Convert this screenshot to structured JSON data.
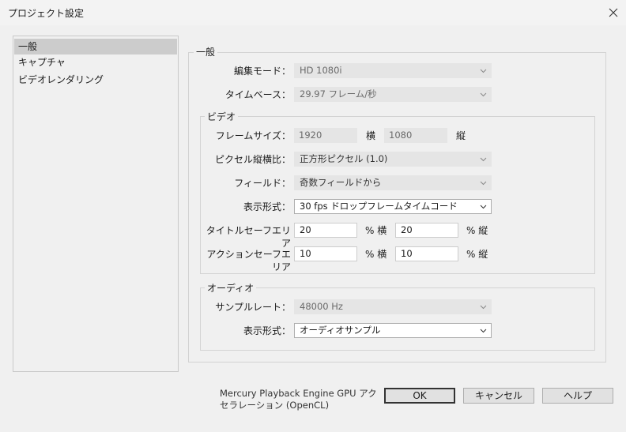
{
  "window": {
    "title": "プロジェクト設定",
    "close_icon": "close-icon"
  },
  "sidebar": {
    "items": [
      {
        "label": "一般",
        "selected": true
      },
      {
        "label": "キャプチャ",
        "selected": false
      },
      {
        "label": "ビデオレンダリング",
        "selected": false
      }
    ]
  },
  "general": {
    "group_label": "一般",
    "edit_mode": {
      "label": "編集モード：",
      "value": "HD 1080i"
    },
    "timebase": {
      "label": "タイムベース：",
      "value": "29.97 フレーム/秒"
    },
    "video": {
      "group_label": "ビデオ",
      "frame_size": {
        "label": "フレームサイズ：",
        "width": "1920",
        "width_unit": "横",
        "height": "1080",
        "height_unit": "縦"
      },
      "pixel_aspect": {
        "label": "ピクセル縦横比：",
        "value": "正方形ピクセル (1.0)"
      },
      "fields": {
        "label": "フィールド：",
        "value": "奇数フィールドから"
      },
      "display_format": {
        "label": "表示形式：",
        "value": "30 fps ドロップフレームタイムコード"
      },
      "title_safe": {
        "label": "タイトルセーフエリア",
        "h": "20",
        "h_unit": "% 横",
        "v": "20",
        "v_unit": "% 縦"
      },
      "action_safe": {
        "label": "アクションセーフエリア",
        "h": "10",
        "h_unit": "% 横",
        "v": "10",
        "v_unit": "% 縦"
      }
    },
    "audio": {
      "group_label": "オーディオ",
      "sample_rate": {
        "label": "サンプルレート：",
        "value": "48000 Hz"
      },
      "display_format": {
        "label": "表示形式：",
        "value": "オーディオサンプル"
      }
    }
  },
  "footer": {
    "renderer_note": "Mercury Playback Engine GPU アクセラレーション (OpenCL)",
    "ok": "OK",
    "cancel": "キャンセル",
    "help": "ヘルプ"
  }
}
